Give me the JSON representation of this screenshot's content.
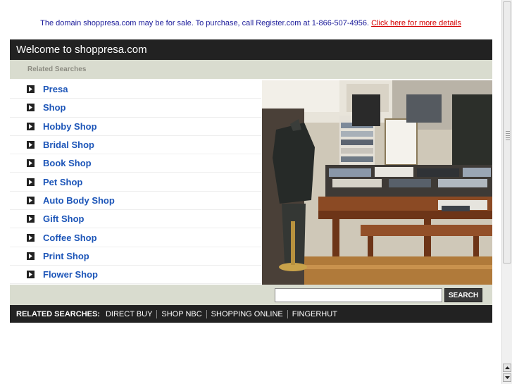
{
  "banner": {
    "text": "The domain shoppresa.com may be for sale. To purchase, call Register.com at 1-866-507-4956.",
    "link": "Click here for more details"
  },
  "header": {
    "title": "Welcome to shoppresa.com"
  },
  "related": {
    "heading": "Related Searches",
    "items": [
      {
        "label": "Presa"
      },
      {
        "label": "Shop"
      },
      {
        "label": "Hobby Shop"
      },
      {
        "label": "Bridal Shop"
      },
      {
        "label": "Book Shop"
      },
      {
        "label": "Pet Shop"
      },
      {
        "label": "Auto Body Shop"
      },
      {
        "label": "Gift Shop"
      },
      {
        "label": "Coffee Shop"
      },
      {
        "label": "Print Shop"
      },
      {
        "label": "Flower Shop"
      }
    ]
  },
  "search": {
    "value": "",
    "button_label": "SEARCH"
  },
  "footer": {
    "label": "RELATED SEARCHES:",
    "links": [
      {
        "label": "DIRECT BUY"
      },
      {
        "label": "SHOP NBC"
      },
      {
        "label": "SHOPPING ONLINE"
      },
      {
        "label": "FINGERHUT"
      }
    ]
  },
  "colors": {
    "link": "#1c55b8",
    "bar_dark": "#222222",
    "bar_light": "#d9dccf",
    "banner_text": "#1b1b9a",
    "banner_link": "#d40000"
  }
}
